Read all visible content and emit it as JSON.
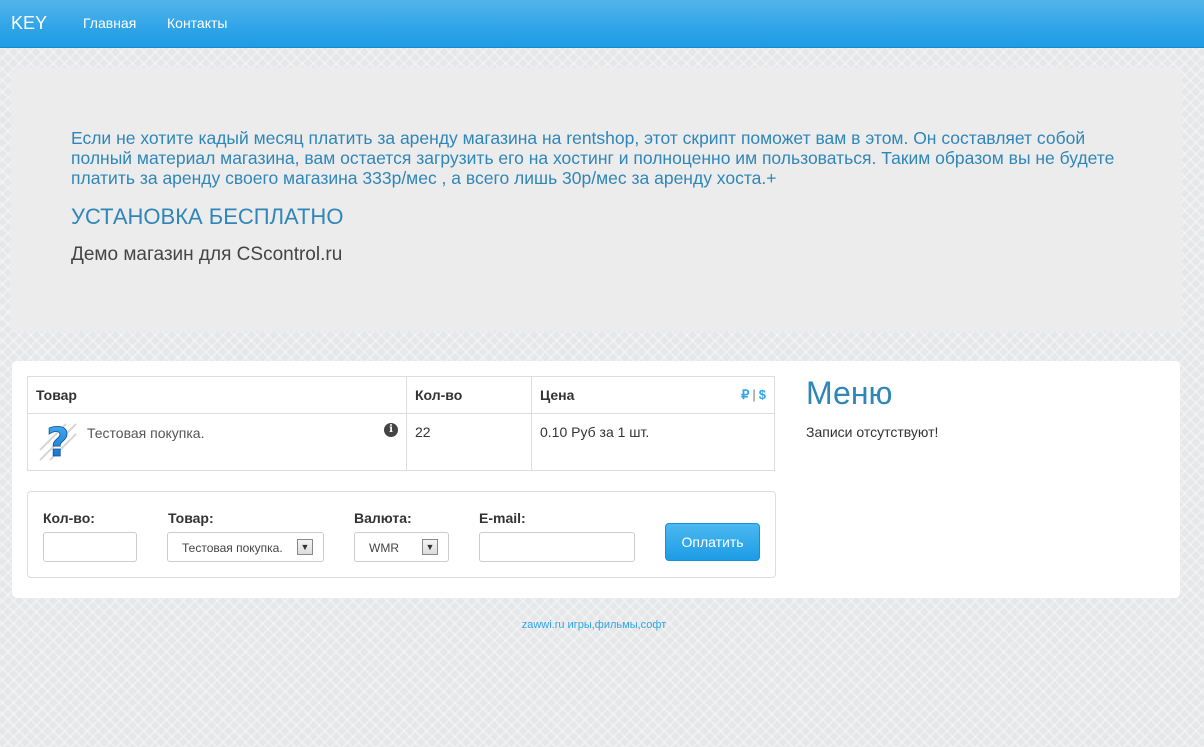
{
  "navbar": {
    "brand": "KEY",
    "links": [
      "Главная",
      "Контакты"
    ]
  },
  "jumbotron": {
    "text": "Если не хотите кадый месяц платить за аренду магазина на rentshop, этот скрипт поможет вам в этом. Он составляет собой полный материал магазина, вам остается загрузить его на хостинг и полноценно им пользоваться. Таким образом вы не будете платить за аренду своего магазина 333р/мес , а всего лишь 30р/мес за аренду хоста.+",
    "heading": "УСТАНОВКА БЕСПЛАТНО",
    "subheading": "Демо магазин для CScontrol.ru"
  },
  "products_table": {
    "headers": [
      "Товар",
      "Кол-во",
      "Цена"
    ],
    "currency_switch": [
      "₽",
      "$"
    ],
    "rows": [
      {
        "icon": "question-icon",
        "name": "Тестовая покупка.",
        "qty": "22",
        "price": "0.10 Руб за 1 шт."
      }
    ]
  },
  "order_form": {
    "qty_label": "Кол-во:",
    "qty_value": "",
    "product_label": "Товар:",
    "product_selected": "Тестовая покупка.",
    "currency_label": "Валюта:",
    "currency_selected": "WMR",
    "email_label": "E-mail:",
    "email_value": "",
    "pay_button": "Оплатить"
  },
  "sidebar": {
    "title": "Меню",
    "empty_text": "Записи отсутствуют!"
  },
  "footer": {
    "link_text": "zawwi.ru игры,фильмы,софт"
  },
  "colors": {
    "navbar": "#2fa4e7",
    "accent_text": "#2f86b8",
    "link": "#2fa4e7"
  }
}
